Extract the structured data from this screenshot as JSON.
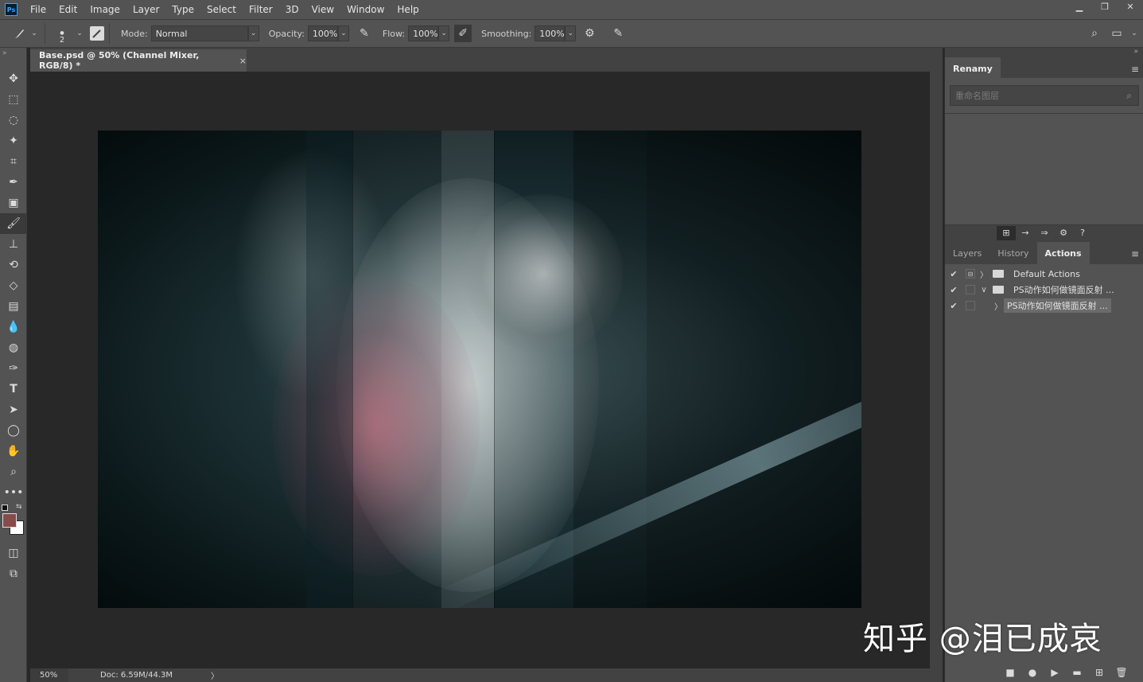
{
  "menubar": {
    "logo": "Ps",
    "items": [
      "File",
      "Edit",
      "Image",
      "Layer",
      "Type",
      "Select",
      "Filter",
      "3D",
      "View",
      "Window",
      "Help"
    ],
    "window_controls": [
      "minimize-icon",
      "restore-icon",
      "close-icon"
    ]
  },
  "options": {
    "brush_size": "2",
    "mode_label": "Mode:",
    "mode_value": "Normal",
    "opacity_label": "Opacity:",
    "opacity_value": "100%",
    "flow_label": "Flow:",
    "flow_value": "100%",
    "smoothing_label": "Smoothing:",
    "smoothing_value": "100%"
  },
  "document": {
    "tab_title": "Base.psd @ 50% (Channel Mixer, RGB/8) *",
    "tab_close": "×",
    "zoom": "50%",
    "doc_size": "Doc: 6.59M/44.3M",
    "status_arrow": "〉"
  },
  "tools": [
    "move-tool",
    "marquee-tool",
    "lasso-tool",
    "magic-wand-tool",
    "crop-tool",
    "eyedropper-tool",
    "frame-tool",
    "brush-tool",
    "stamp-tool",
    "history-brush-tool",
    "eraser-tool",
    "gradient-tool",
    "blur-tool",
    "dodge-tool",
    "pen-tool",
    "type-tool",
    "path-selection-tool",
    "ellipse-tool",
    "hand-tool",
    "zoom-tool",
    "more-tools"
  ],
  "colors": {
    "foreground": "#8a4a4a",
    "background": "#ffffff"
  },
  "renamy": {
    "tab": "Renamy",
    "search_placeholder": "重命名图层"
  },
  "actions_panel": {
    "tabs": [
      "Layers",
      "History",
      "Actions"
    ],
    "active_tab": "Actions",
    "rows": [
      {
        "check": "✔",
        "dialog": "⊟",
        "arrow": "〉",
        "name": "Default Actions",
        "folder": true
      },
      {
        "check": "✔",
        "dialog": "",
        "arrow": "∨",
        "name": "PS动作如何做镜面反射 ...",
        "folder": true
      },
      {
        "check": "✔",
        "dialog": "",
        "arrow": "〉",
        "name": "PS动作如何做镜面反射 ...",
        "folder": false
      }
    ]
  },
  "watermark": "知乎 @泪已成哀"
}
